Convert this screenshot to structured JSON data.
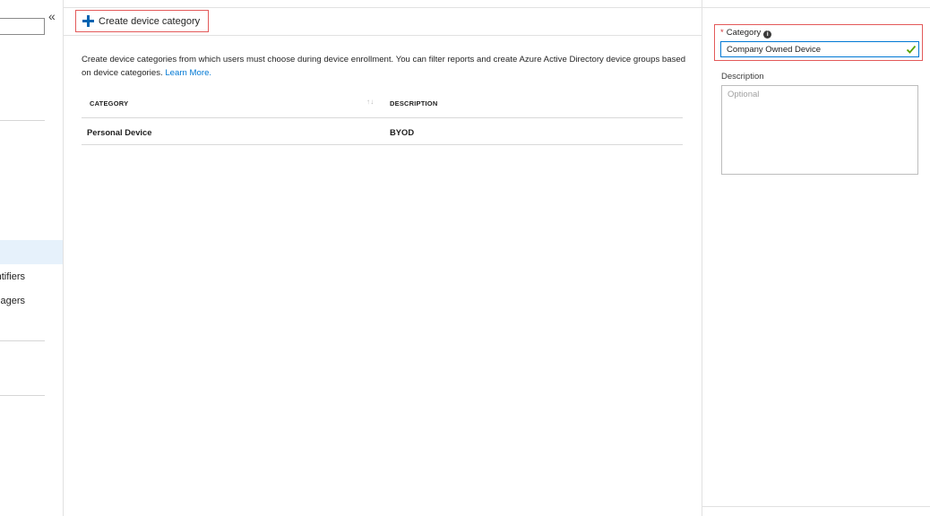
{
  "sidebar": {
    "collapse_glyph": "«",
    "items": [
      {
        "label": "Device identifiers",
        "selected": false
      },
      {
        "label": "Device enrollment managers",
        "selected": false
      }
    ]
  },
  "toolbar": {
    "create_label": "Create device category"
  },
  "main": {
    "intro_text": "Create device categories from which users must choose during device enrollment. You can filter reports and create Azure Active Directory device groups based on device categories.",
    "learn_more_label": "Learn More.",
    "table": {
      "headers": {
        "category": "CATEGORY",
        "description": "DESCRIPTION"
      },
      "sort_glyph": "↑↓",
      "rows": [
        {
          "category": "Personal Device",
          "description": "BYOD"
        }
      ]
    }
  },
  "blade": {
    "category_label": "Category",
    "required_marker": "*",
    "info_glyph": "i",
    "category_value": "Company Owned Device",
    "description_label": "Description",
    "description_placeholder": "Optional"
  },
  "colors": {
    "accent": "#0078d4",
    "plus": "#0063b1",
    "highlight_border": "#e35a5a",
    "valid_check": "#57a300",
    "selected_nav": "#e6f1fb"
  }
}
